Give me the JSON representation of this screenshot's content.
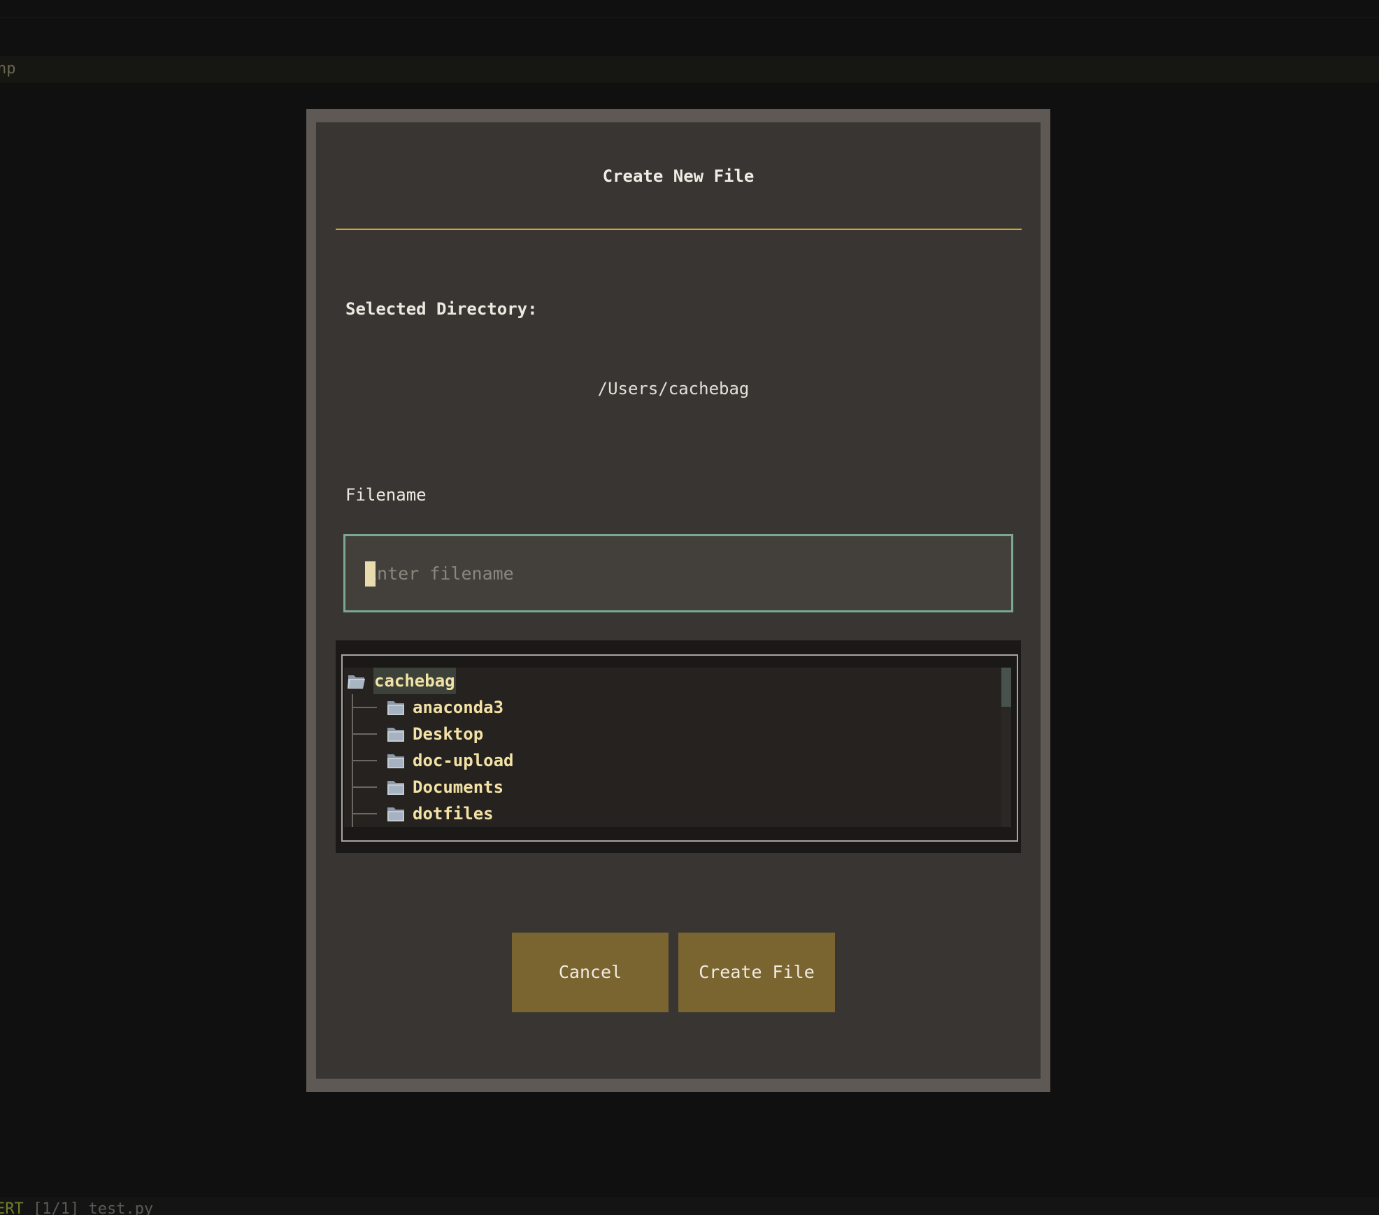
{
  "background": {
    "cursor_line_text": "np",
    "status_mode": "ERT",
    "status_rest": " [1/1] test.py"
  },
  "dialog": {
    "title": "Create New File",
    "selected_directory_label": "Selected Directory:",
    "selected_directory_value": "/Users/cachebag",
    "filename_label": "Filename",
    "filename_value": "",
    "filename_placeholder": "Enter filename"
  },
  "tree": {
    "root": {
      "label": "cachebag",
      "icon": "folder-open-icon",
      "selected": true
    },
    "children": [
      {
        "label": "anaconda3",
        "icon": "folder-icon"
      },
      {
        "label": "Desktop",
        "icon": "folder-icon"
      },
      {
        "label": "doc-upload",
        "icon": "folder-icon"
      },
      {
        "label": "Documents",
        "icon": "folder-icon"
      },
      {
        "label": "dotfiles",
        "icon": "folder-icon"
      }
    ]
  },
  "buttons": {
    "cancel_label": "Cancel",
    "create_label": "Create File"
  },
  "colors": {
    "accent_rule": "#d4a925",
    "input_border": "#7ba891",
    "button_bg": "#7a6531",
    "tree_text": "#f3e2a6"
  }
}
